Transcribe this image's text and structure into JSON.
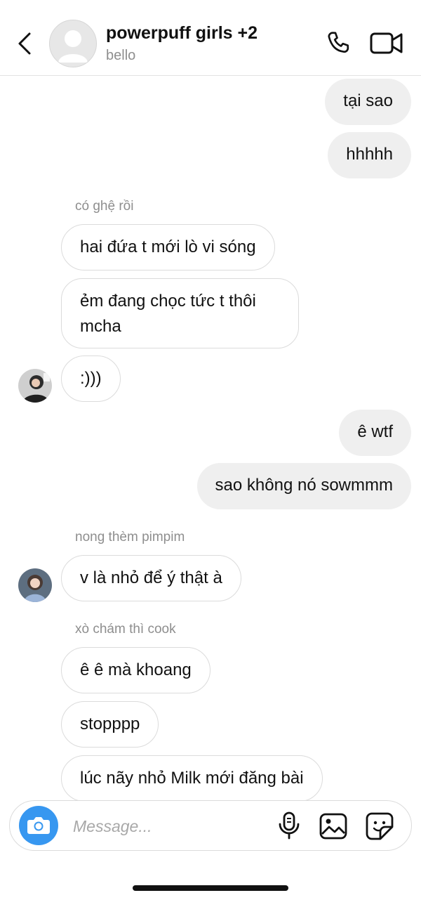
{
  "header": {
    "title": "powerpuff girls +2",
    "subtitle": "bello"
  },
  "messages": {
    "m1": "tại sao",
    "m2": "hhhhh",
    "sender1": "có ghệ rồi",
    "m3": "hai đứa t mới lò vi sóng",
    "m4": "ẻm đang chọc tức t thôi mcha",
    "m5": ":)))",
    "m6": "ê wtf",
    "m7": "sao không nó sowmmm",
    "sender2": "nong thèm pimpim",
    "m8": "v là nhỏ để ý thật à",
    "sender3": "xò chám thì cook",
    "m9": "ê ê mà khoang",
    "m10": "stopppp",
    "m11": "lúc nãy nhỏ Milk mới đăng bài"
  },
  "composer": {
    "placeholder": "Message...",
    "accent": "#3797f0"
  },
  "icons": {
    "back": "chevron-left-icon",
    "call": "phone-icon",
    "video": "video-camera-icon",
    "camera": "camera-icon",
    "mic": "microphone-icon",
    "gallery": "image-icon",
    "sticker": "sticker-icon"
  }
}
